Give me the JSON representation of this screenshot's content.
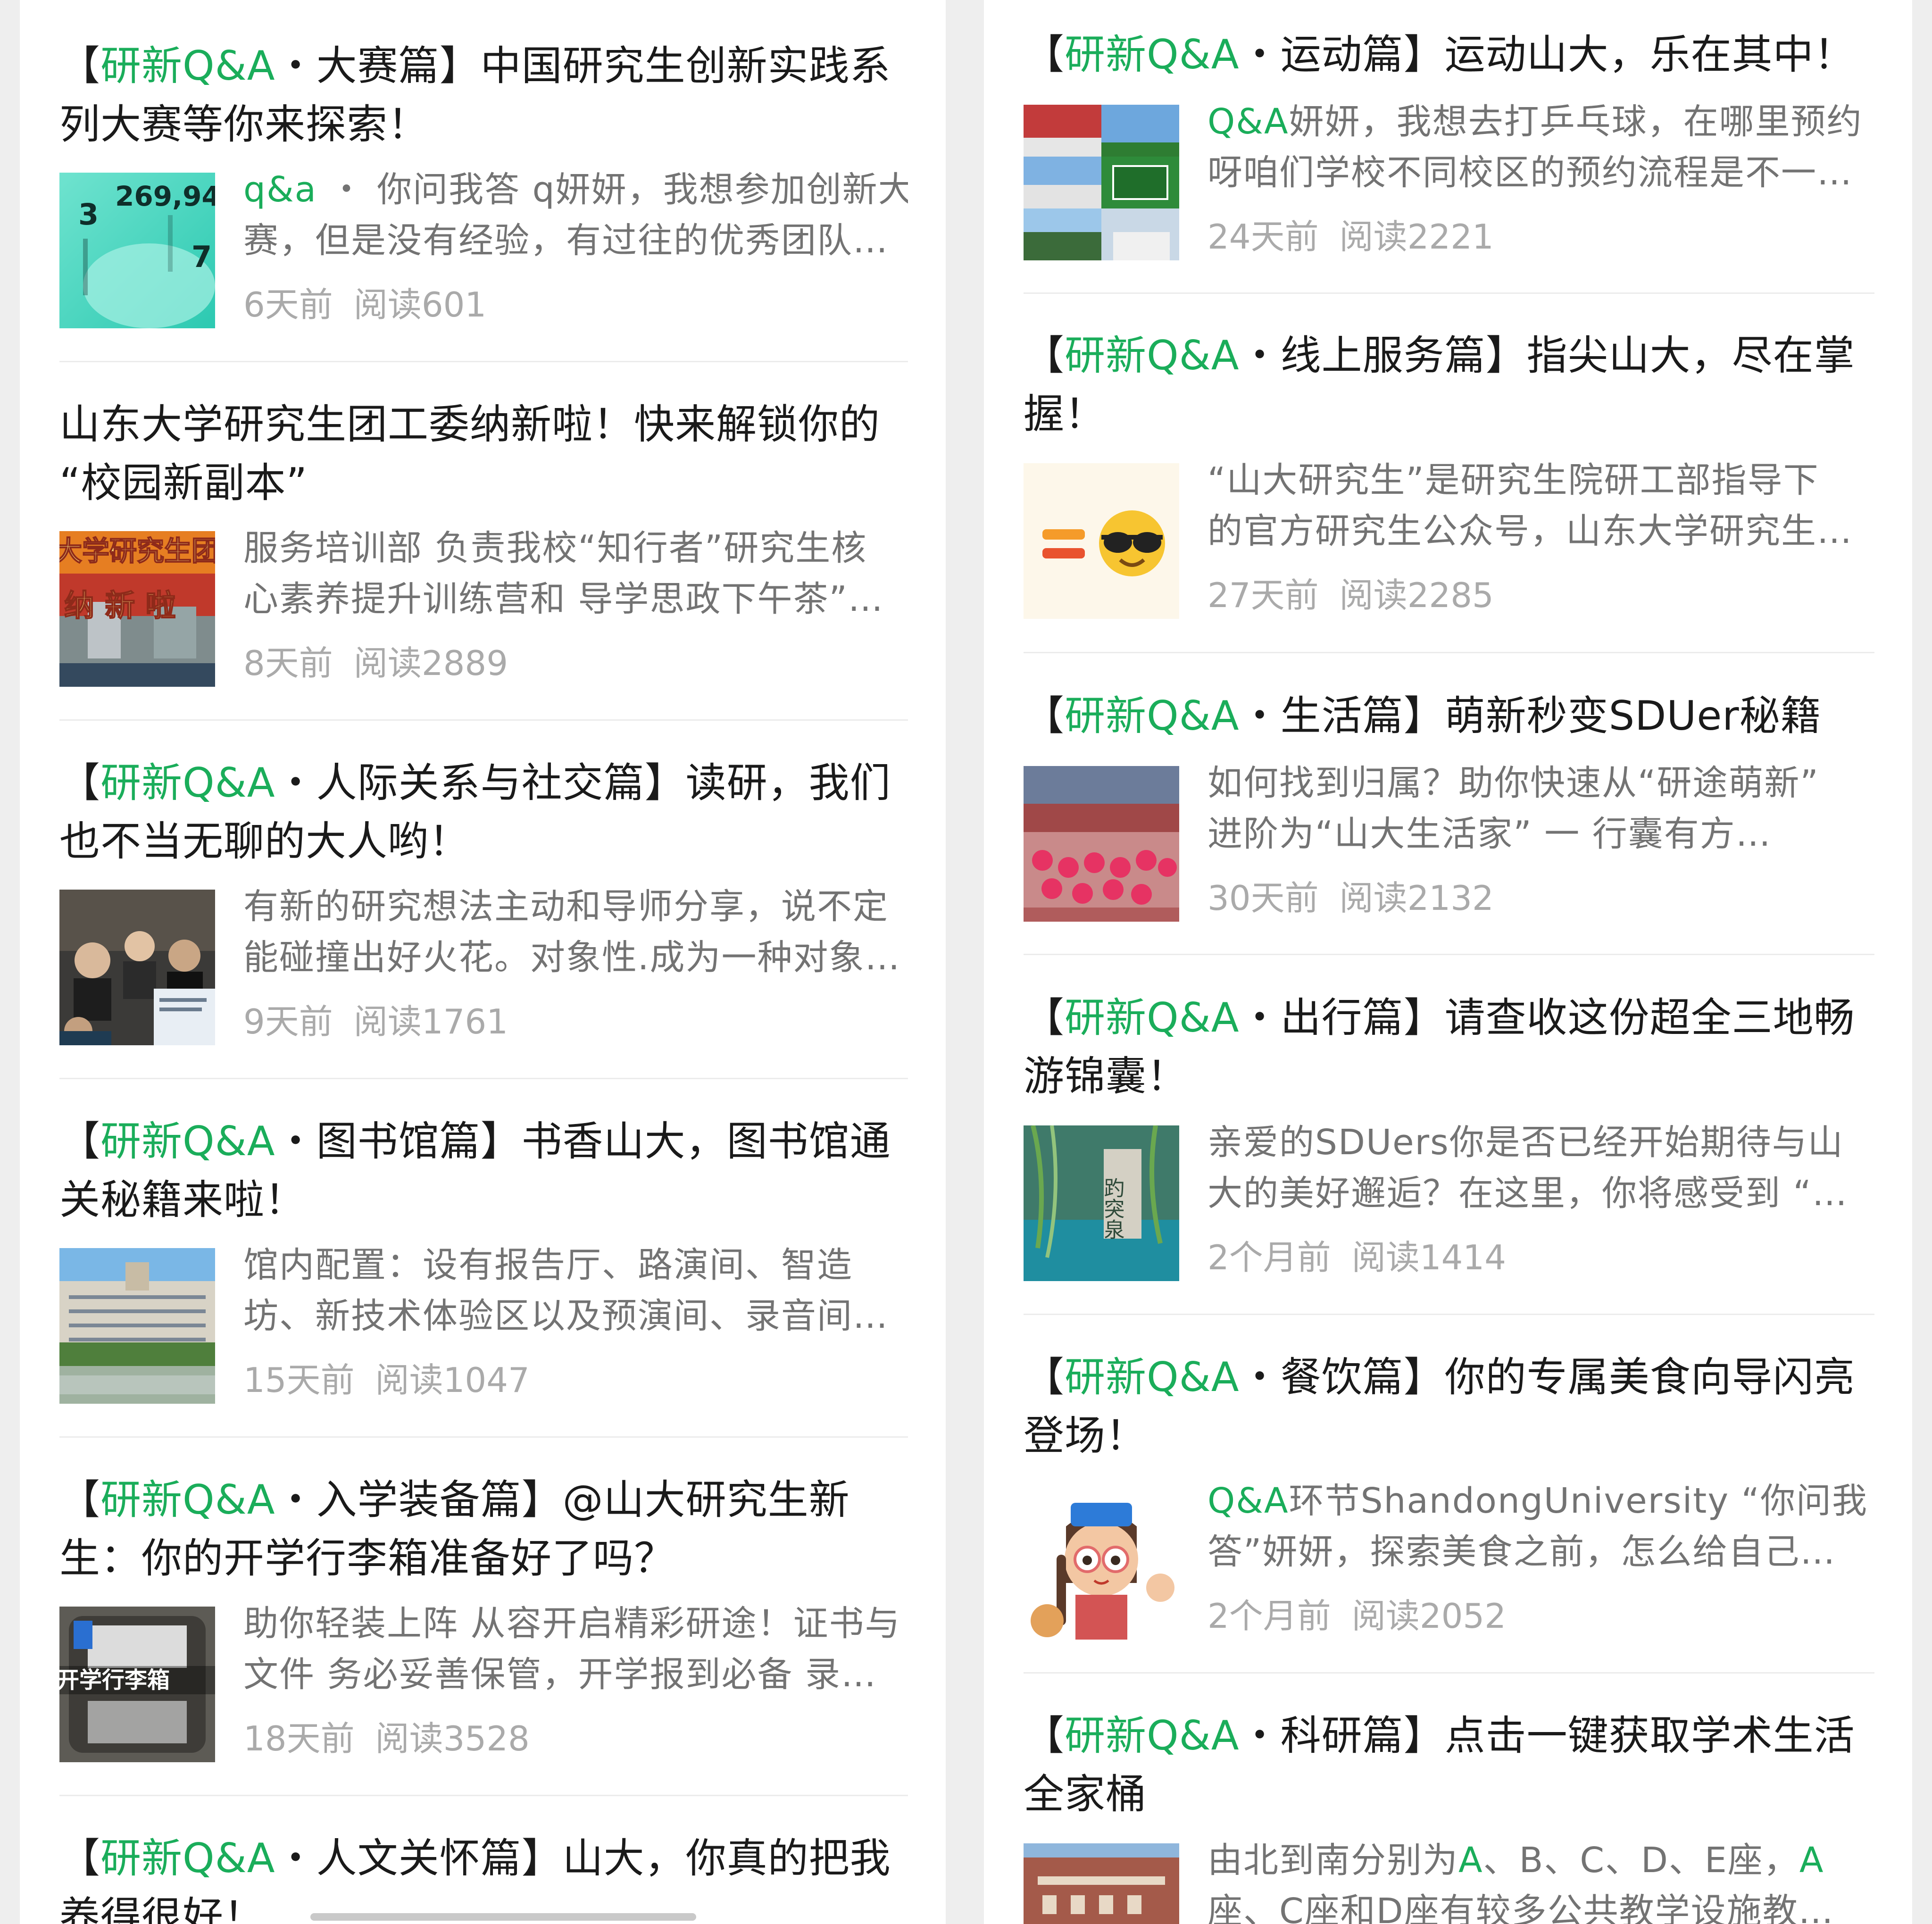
{
  "left": {
    "articles": [
      {
        "prefix": "【",
        "tag": "研新Q&A",
        "title_rest": "・大赛篇】中国研究生创新实践系",
        "title_line2": "列大赛等你来探索！",
        "sum_hl": "q&a",
        "sum1": " ・ 你问我答 q妍妍，我想参加创新大",
        "sum2": "赛，但是没有经验，有过往的优秀团队…",
        "time": "6天前",
        "reads": "阅读601",
        "thumb": "innovation-stats"
      },
      {
        "prefix": "",
        "tag": "",
        "title_rest": "山东大学研究生团工委纳新啦！快来解锁你的",
        "title_line2": "“校园新副本”",
        "sum_hl": "",
        "sum1": "服务培训部 负责我校“知行者”研究生核",
        "sum2": "心素养提升训练营和 导学思政下午茶”…",
        "time": "8天前",
        "reads": "阅读2889",
        "thumb": "recruit-poster"
      },
      {
        "prefix": "【",
        "tag": "研新Q&A",
        "title_rest": "・人际关系与社交篇】读研，我们",
        "title_line2": "也不当无聊的大人哟！",
        "sum_hl": "",
        "sum1": "有新的研究想法主动和导师分享，说不定",
        "sum2": "能碰撞出好火花。对象性.成为一种对象…",
        "time": "9天前",
        "reads": "阅读1761",
        "thumb": "classroom-photo"
      },
      {
        "prefix": "【",
        "tag": "研新Q&A",
        "title_rest": "・图书馆篇】书香山大，图书馆通",
        "title_line2": "关秘籍来啦！",
        "sum_hl": "",
        "sum1": "馆内配置：设有报告厅、路演间、智造",
        "sum2": "坊、新技术体验区以及预演间、录音间…",
        "time": "15天前",
        "reads": "阅读1047",
        "thumb": "library-photo"
      },
      {
        "prefix": "【",
        "tag": "研新Q&A",
        "title_rest": "・入学装备篇】@山大研究生新",
        "title_line2": "生：你的开学行李箱准备好了吗？",
        "sum_hl": "",
        "sum1": "助你轻装上阵 从容开启精彩研途！证书与",
        "sum2": "文件 务必妥善保管，开学报到必备 录…",
        "time": "18天前",
        "reads": "阅读3528",
        "thumb": "luggage-photo"
      },
      {
        "prefix": "【",
        "tag": "研新Q&A",
        "title_rest": "・人文关怀篇】山大，你真的把我",
        "title_line2": "养得很好！"
      }
    ],
    "thumb_texts": {
      "stat1": "3",
      "stat2": "269,94",
      "stat3": "7",
      "recruit1": "大学研究生团",
      "recruit2": "纳 新 啦",
      "luggage": "开学行李箱"
    }
  },
  "right": {
    "articles": [
      {
        "prefix": "【",
        "tag": "研新Q&A",
        "title_rest": "・运动篇】运动山大，乐在其中！",
        "title_line2": "",
        "sum_hl": "Q&A",
        "sum1": "妍妍，我想去打乒乓球，在哪里预约",
        "sum2": "呀咱们学校不同校区的预约流程是不一…",
        "time": "24天前",
        "reads": "阅读2221",
        "thumb": "sports-collage"
      },
      {
        "prefix": "【",
        "tag": "研新Q&A",
        "title_rest": "・线上服务篇】指尖山大，尽在掌",
        "title_line2": "握！",
        "sum_hl": "",
        "sum1": "“山大研究生”是研究生院研工部指导下",
        "sum2": "的官方研究生公众号，山东大学研究生…",
        "time": "27天前",
        "reads": "阅读2285",
        "thumb": "emoji-sunglasses"
      },
      {
        "prefix": "【",
        "tag": "研新Q&A",
        "title_rest": "・生活篇】萌新秒变SDUer秘籍",
        "title_line2": "",
        "sum_hl": "",
        "sum1": "如何找到归属？助你快速从“研途萌新”",
        "sum2": "进阶为“山大生活家” 一 行囊有方…",
        "time": "30天前",
        "reads": "阅读2132",
        "thumb": "gym-photo"
      },
      {
        "prefix": "【",
        "tag": "研新Q&A",
        "title_rest": "・出行篇】请查收这份超全三地畅",
        "title_line2": "游锦囊！",
        "sum_hl": "",
        "sum1": "亲爱的SDUers你是否已经开始期待与山",
        "sum2": "大的美好邂逅？在这里，你将感受到 “…",
        "time": "2个月前",
        "reads": "阅读1414",
        "thumb": "spring-photo"
      },
      {
        "prefix": "【",
        "tag": "研新Q&A",
        "title_rest": "・餐饮篇】你的专属美食向导闪亮",
        "title_line2": "登场！",
        "sum_hl": "Q&A",
        "sum1": "环节ShandongUniversity “你问我",
        "sum2": "答”妍妍，探索美食之前，怎么给自己…",
        "time": "2个月前",
        "reads": "阅读2052",
        "thumb": "girl-illustration"
      },
      {
        "prefix": "【",
        "tag": "研新Q&A",
        "title_rest": "・科研篇】点击一键获取学术生活",
        "title_line2": "全家桶",
        "sum_pre": "由北到南分别为",
        "sum_hl": "A",
        "sum1": "、B、C、D、E座，",
        "sum_hl2": "A",
        "sum2": "座、C座和D座有较多公共教学设施教…",
        "thumb": "building-photo"
      }
    ],
    "thumb_texts": {
      "spring": "趵突泉"
    }
  },
  "colors": {
    "accent": "#1aad5a",
    "title": "#1a1a1a",
    "summary": "#737373",
    "meta": "#aaaaaa"
  }
}
